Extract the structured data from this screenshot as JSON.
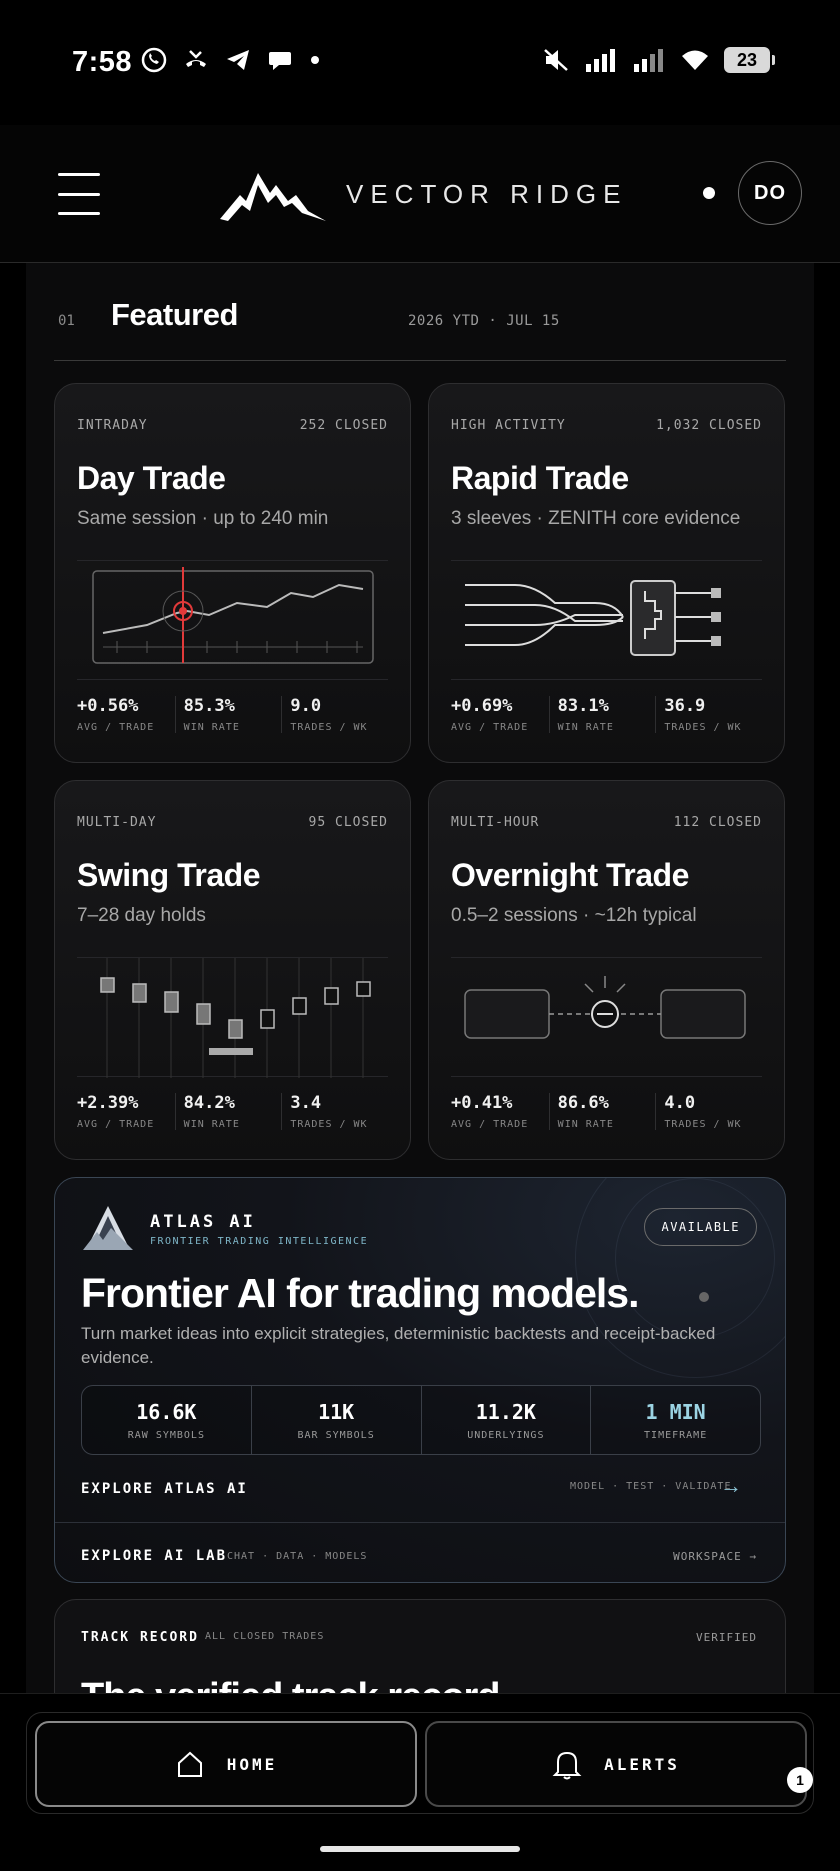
{
  "status_bar": {
    "time": "7:58",
    "battery": "23"
  },
  "header": {
    "brand": "VECTOR RIDGE",
    "avatar_initials": "DO"
  },
  "section": {
    "number": "01",
    "title": "Featured",
    "date": "2026 YTD · JUL 15"
  },
  "cards": [
    {
      "kicker": "INTRADAY",
      "closed": "252 CLOSED",
      "title": "Day Trade",
      "subtitle": "Same session · up to 240 min",
      "stats": [
        {
          "value": "+0.56%",
          "label": "AVG / TRADE"
        },
        {
          "value": "85.3%",
          "label": "WIN RATE"
        },
        {
          "value": "9.0",
          "label": "TRADES / WK"
        }
      ]
    },
    {
      "kicker": "HIGH ACTIVITY",
      "closed": "1,032 CLOSED",
      "title": "Rapid Trade",
      "subtitle": "3 sleeves · ZENITH core evidence",
      "stats": [
        {
          "value": "+0.69%",
          "label": "AVG / TRADE"
        },
        {
          "value": "83.1%",
          "label": "WIN RATE"
        },
        {
          "value": "36.9",
          "label": "TRADES / WK"
        }
      ]
    },
    {
      "kicker": "MULTI-DAY",
      "closed": "95 CLOSED",
      "title": "Swing Trade",
      "subtitle": "7–28 day holds",
      "stats": [
        {
          "value": "+2.39%",
          "label": "AVG / TRADE"
        },
        {
          "value": "84.2%",
          "label": "WIN RATE"
        },
        {
          "value": "3.4",
          "label": "TRADES / WK"
        }
      ]
    },
    {
      "kicker": "MULTI-HOUR",
      "closed": "112 CLOSED",
      "title": "Overnight Trade",
      "subtitle": "0.5–2 sessions · ~12h typical",
      "stats": [
        {
          "value": "+0.41%",
          "label": "AVG / TRADE"
        },
        {
          "value": "86.6%",
          "label": "WIN RATE"
        },
        {
          "value": "4.0",
          "label": "TRADES / WK"
        }
      ]
    }
  ],
  "atlas": {
    "name": "ATLAS AI",
    "tagline": "FRONTIER TRADING INTELLIGENCE",
    "badge": "AVAILABLE",
    "headline": "Frontier AI for trading models.",
    "description": "Turn market ideas into explicit strategies, deterministic backtests and receipt-backed evidence.",
    "metrics": [
      {
        "value": "16.6K",
        "label": "RAW SYMBOLS"
      },
      {
        "value": "11K",
        "label": "BAR SYMBOLS"
      },
      {
        "value": "11.2K",
        "label": "UNDERLYINGS"
      },
      {
        "value": "1 MIN",
        "label": "TIMEFRAME"
      }
    ],
    "explore_label": "EXPLORE ATLAS AI",
    "explore_meta": "MODEL · TEST · VALIDATE",
    "explore_arrow": "→",
    "lab_label": "EXPLORE AI LAB",
    "lab_meta": "CHAT · DATA · MODELS",
    "workspace_label": "WORKSPACE →",
    "accent": "#9cd4e4"
  },
  "track": {
    "kicker": "TRACK RECORD",
    "sub": "ALL CLOSED TRADES",
    "verified": "VERIFIED",
    "headline": "The verified track record"
  },
  "nav": {
    "home": "HOME",
    "alerts": "ALERTS",
    "alerts_badge": "1"
  }
}
